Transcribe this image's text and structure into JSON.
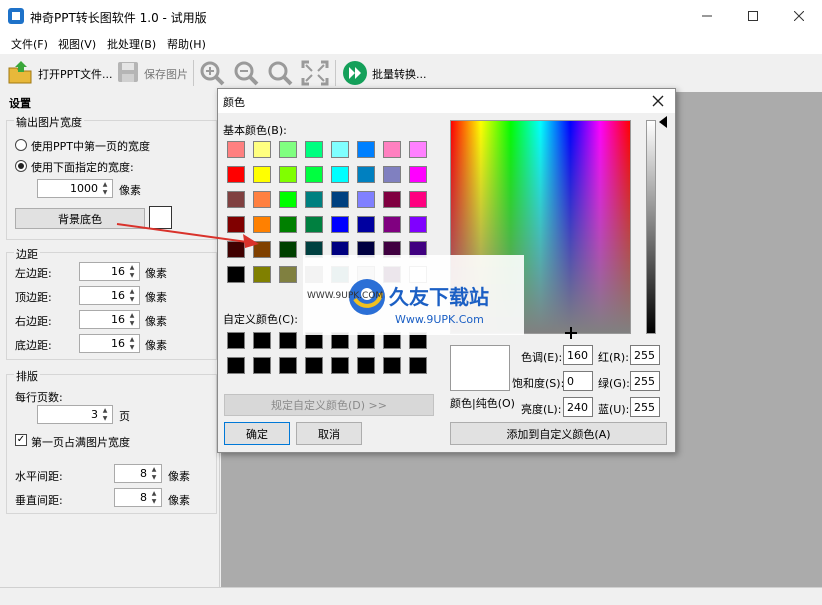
{
  "window": {
    "title": "神奇PPT转长图软件 1.0 - 试用版"
  },
  "menu": [
    "文件(F)",
    "视图(V)",
    "批处理(B)",
    "帮助(H)"
  ],
  "toolbar": {
    "open": "打开PPT文件...",
    "save": "保存图片",
    "batch": "批量转换..."
  },
  "settings": {
    "header": "设置",
    "output_group": "输出图片宽度",
    "radio_first": "使用PPT中第一页的宽度",
    "radio_custom": "使用下面指定的宽度:",
    "width_value": "1000",
    "px": "像素",
    "bg_button": "背景底色",
    "margin_group": "边距",
    "margin_left": "左边距:",
    "margin_top": "顶边距:",
    "margin_right": "右边距:",
    "margin_bottom": "底边距:",
    "margin_value": "16",
    "layout_group": "排版",
    "pages_per_row": "每行页数:",
    "pages_value": "3",
    "page_unit": "页",
    "first_page_full": "第一页占满图片宽度",
    "h_spacing": "水平间距:",
    "v_spacing": "垂直间距:",
    "spacing_value": "8"
  },
  "dialog": {
    "title": "颜色",
    "basic_colors": "基本颜色(B):",
    "custom_colors": "自定义颜色(C):",
    "define_custom": "规定自定义颜色(D) >>",
    "ok": "确定",
    "cancel": "取消",
    "hue_label": "色调(E):",
    "hue": "160",
    "sat_label": "饱和度(S):",
    "sat": "0",
    "lum_label": "亮度(L):",
    "lum": "240",
    "red_label": "红(R):",
    "red": "255",
    "green_label": "绿(G):",
    "green": "255",
    "blue_label": "蓝(U):",
    "blue": "255",
    "color_solid": "颜色|纯色(O)",
    "add_custom": "添加到自定义颜色(A)"
  },
  "basic_palette": [
    [
      "#ff8080",
      "#ffff80",
      "#80ff80",
      "#00ff80",
      "#80ffff",
      "#0080ff",
      "#ff80c0",
      "#ff80ff"
    ],
    [
      "#ff0000",
      "#ffff00",
      "#80ff00",
      "#00ff40",
      "#00ffff",
      "#0080c0",
      "#8080c0",
      "#ff00ff"
    ],
    [
      "#804040",
      "#ff8040",
      "#00ff00",
      "#008080",
      "#004080",
      "#8080ff",
      "#800040",
      "#ff0080"
    ],
    [
      "#800000",
      "#ff8000",
      "#008000",
      "#008040",
      "#0000ff",
      "#0000a0",
      "#800080",
      "#8000ff"
    ],
    [
      "#400000",
      "#804000",
      "#004000",
      "#004040",
      "#000080",
      "#000040",
      "#400040",
      "#400080"
    ],
    [
      "#000000",
      "#808000",
      "#808040",
      "#808080",
      "#408080",
      "#c0c0c0",
      "#400040",
      "#ffffff"
    ]
  ],
  "custom_palette": [
    [
      "#000000",
      "#000000",
      "#000000",
      "#000000",
      "#000000",
      "#000000",
      "#000000",
      "#000000"
    ],
    [
      "#000000",
      "#000000",
      "#000000",
      "#000000",
      "#000000",
      "#000000",
      "#000000",
      "#000000"
    ]
  ],
  "watermark": {
    "brand": "久友下载站",
    "url": "WWW.9UPK.COM",
    "url2": "Www.9UPK.Com"
  }
}
